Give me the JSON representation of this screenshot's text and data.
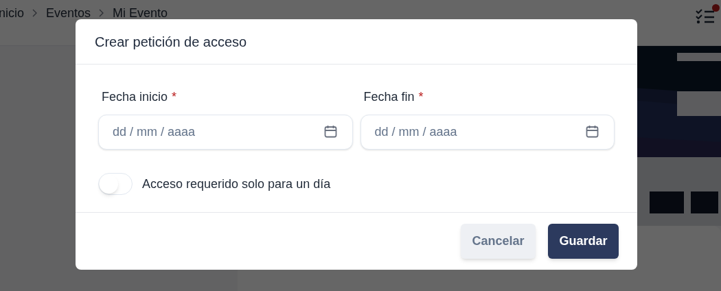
{
  "page": {
    "breadcrumb": [
      "nicio",
      "Eventos",
      "Mi Evento"
    ],
    "notification_badge": true
  },
  "dialog": {
    "title": "Crear petición de acceso",
    "fields": [
      {
        "label": "Fecha inicio",
        "required_mark": "*",
        "placeholder": "dd / mm / aaaa"
      },
      {
        "label": "Fecha fin",
        "required_mark": "*",
        "placeholder": "dd / mm / aaaa"
      }
    ],
    "toggle": {
      "label": "Acceso requerido solo para un día",
      "on": false
    },
    "buttons": [
      {
        "label": "Cancelar",
        "kind": "secondary"
      },
      {
        "label": "Guardar",
        "kind": "primary"
      }
    ]
  }
}
